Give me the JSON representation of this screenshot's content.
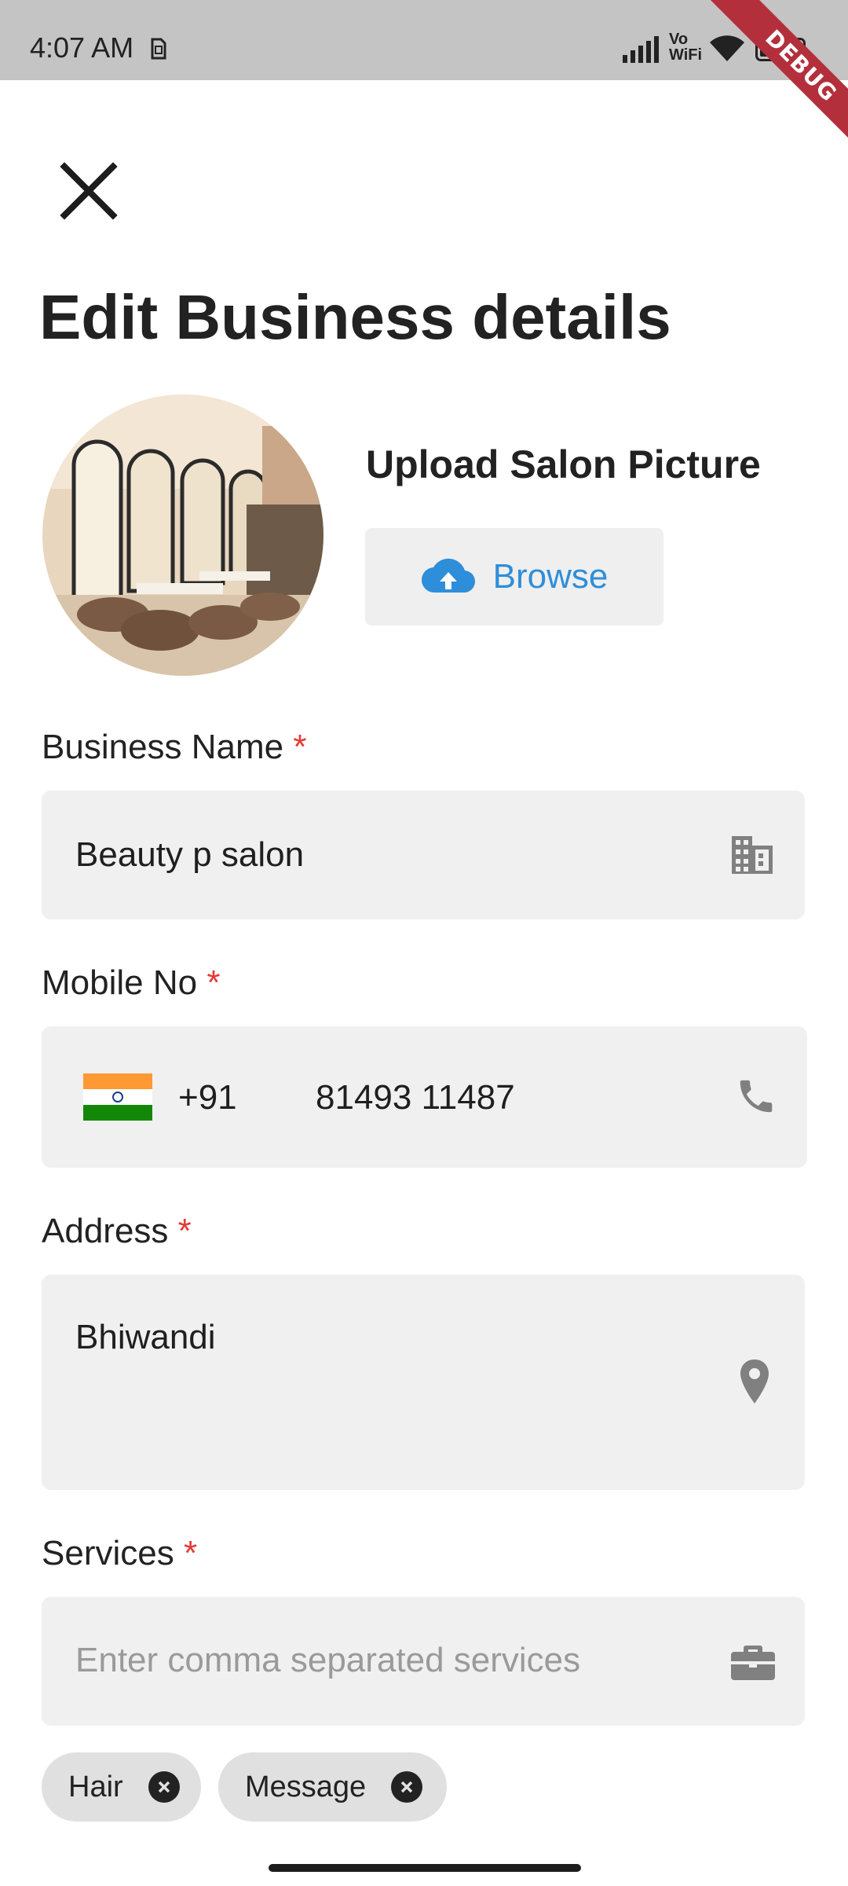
{
  "status_bar": {
    "time": "4:07 AM",
    "battery": "67",
    "icons": [
      "sim-card-icon",
      "signal-icon",
      "vowifi-icon",
      "wifi-icon",
      "battery-icon"
    ],
    "vowifi_text": [
      "Vo",
      "WiFi"
    ]
  },
  "debug_banner": "DEBUG",
  "page": {
    "title": "Edit Business details",
    "close_icon": "close-icon"
  },
  "picture": {
    "upload_label": "Upload Salon Picture",
    "browse_label": "Browse",
    "browse_icon": "cloud-upload-icon",
    "avatar": "salon interior photo"
  },
  "fields": {
    "business_name": {
      "label": "Business Name",
      "required": "*",
      "value": "Beauty p salon",
      "icon": "building-icon"
    },
    "mobile": {
      "label": "Mobile No",
      "required": "*",
      "country_code": "+91",
      "value": "81493 11487",
      "flag": "india-flag-icon",
      "icon": "phone-icon"
    },
    "address": {
      "label": "Address",
      "required": "*",
      "value": "Bhiwandi",
      "icon": "location-pin-icon"
    },
    "services": {
      "label": "Services",
      "required": "*",
      "placeholder": "Enter comma separated services",
      "icon": "briefcase-icon"
    }
  },
  "service_chips": [
    {
      "label": "Hair"
    },
    {
      "label": "Message"
    }
  ],
  "colors": {
    "accent": "#2e8ed9",
    "required": "#e53935",
    "field_bg": "#f0f0f0",
    "status_bar": "#c4c4c4",
    "debug_ribbon": "#b42f3c"
  }
}
